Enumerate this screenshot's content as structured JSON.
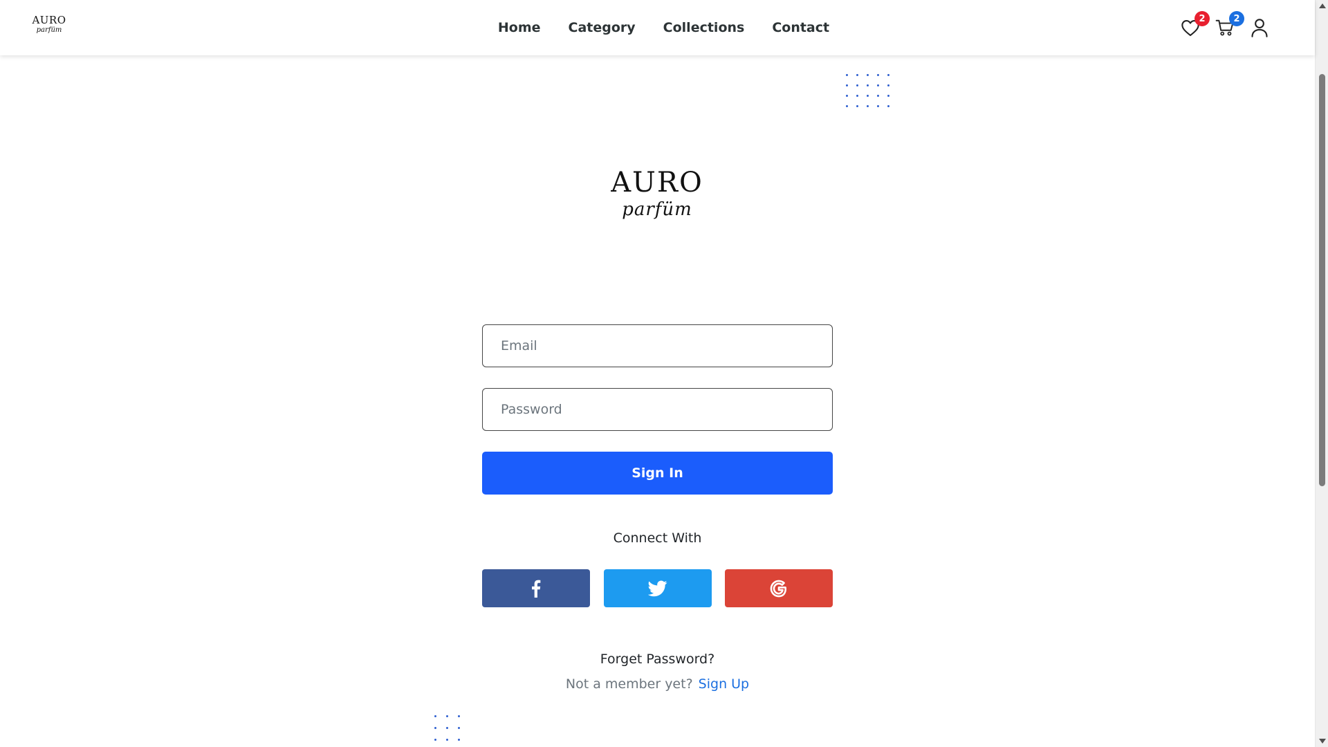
{
  "brand": {
    "name": "AURO",
    "tagline": "parfüm"
  },
  "nav": {
    "items": [
      {
        "label": "Home"
      },
      {
        "label": "Category"
      },
      {
        "label": "Collections"
      },
      {
        "label": "Contact"
      }
    ]
  },
  "header_icons": {
    "wishlist": {
      "icon": "heart-icon",
      "count": "2",
      "badge_color": "#e8202f"
    },
    "cart": {
      "icon": "cart-icon",
      "count": "2",
      "badge_color": "#1b6fe0"
    },
    "account": {
      "icon": "user-icon"
    }
  },
  "login_form": {
    "email_placeholder": "Email",
    "password_placeholder": "Password",
    "submit_label": "Sign In",
    "connect_label": "Connect With",
    "socials": [
      {
        "name": "facebook",
        "icon": "facebook-icon",
        "color": "#3b5998"
      },
      {
        "name": "twitter",
        "icon": "twitter-icon",
        "color": "#1d9bf0"
      },
      {
        "name": "google",
        "icon": "google-icon",
        "color": "#db4437"
      }
    ],
    "forget_label": "Forget Password?",
    "member_prompt": "Not a member yet?",
    "signup_label": "Sign Up"
  },
  "colors": {
    "primary": "#1b5dfc",
    "link": "#1b6fe0",
    "dots": "#2f5fd0"
  }
}
